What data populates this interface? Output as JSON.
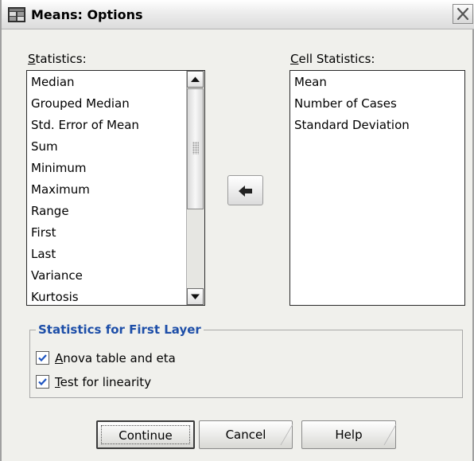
{
  "window": {
    "title": "Means: Options"
  },
  "statistics": {
    "label_accel": "S",
    "label_rest": "tatistics:",
    "items": [
      "Median",
      "Grouped Median",
      "Std. Error of Mean",
      "Sum",
      "Minimum",
      "Maximum",
      "Range",
      "First",
      "Last",
      "Variance",
      "Kurtosis"
    ]
  },
  "cell_statistics": {
    "label_accel": "C",
    "label_rest": "ell Statistics:",
    "items": [
      "Mean",
      "Number of Cases",
      "Standard Deviation"
    ]
  },
  "first_layer": {
    "title": "Statistics for First Layer",
    "anova": {
      "accel": "A",
      "rest": "nova table and eta",
      "checked": true
    },
    "linearity": {
      "accel": "T",
      "rest": "est for linearity",
      "checked": true
    }
  },
  "buttons": {
    "continue": "Continue",
    "cancel": "Cancel",
    "help": "Help"
  },
  "icons": {
    "app": "spss-window-icon",
    "close": "close-icon",
    "move": "right-arrow-icon",
    "check": "checkmark-icon"
  }
}
